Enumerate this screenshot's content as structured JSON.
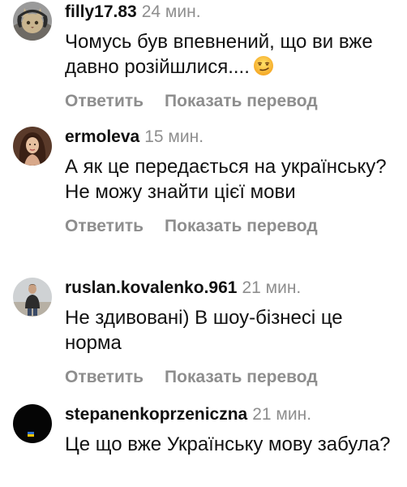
{
  "comments": [
    {
      "username": "filly17.83",
      "time": "24 мин.",
      "text": "Чомусь був впевнений, що ви вже давно розійшлися....",
      "emoji_icon": "smirking-face-icon",
      "reply_label": "Ответить",
      "translate_label": "Показать перевод"
    },
    {
      "username": "ermoleva",
      "time": "15 мин.",
      "text": "А як це передається на українську? Не можу знайти цієї мови",
      "reply_label": "Ответить",
      "translate_label": "Показать перевод"
    },
    {
      "username": "ruslan.kovalenko.961",
      "time": "21 мин.",
      "text": "Не здивовані) В шоу-бізнесі це норма",
      "reply_label": "Ответить",
      "translate_label": "Показать перевод"
    },
    {
      "username": "stepanenkoprzeniczna",
      "time": "21 мин.",
      "text": "Це що вже Українську мову забула?"
    }
  ],
  "colors": {
    "text": "#111111",
    "secondary": "#8e8e8e",
    "background": "#ffffff"
  }
}
